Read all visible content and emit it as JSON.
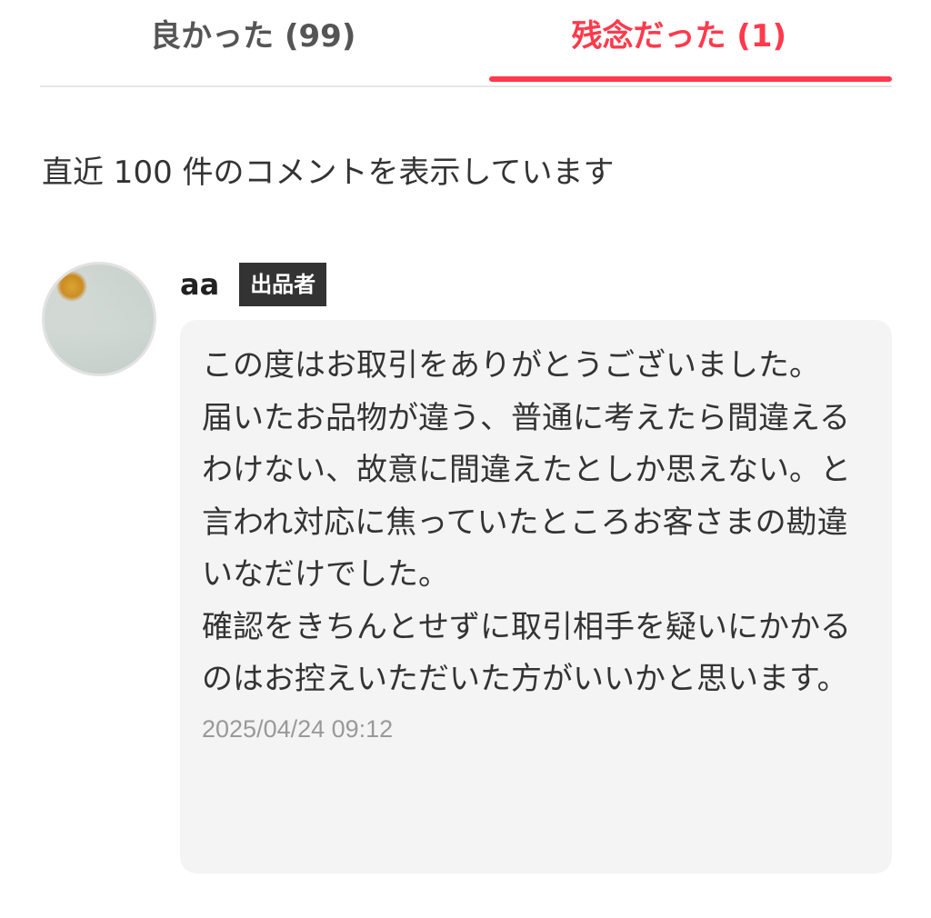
{
  "tabs": [
    {
      "label": "良かった (99)",
      "active": false
    },
    {
      "label": "残念だった (1)",
      "active": true
    }
  ],
  "notice": "直近 100 件のコメントを表示しています",
  "comment": {
    "username": "aa",
    "badge": "出品者",
    "text": "この度はお取引をありがとうございました。\n届いたお品物が違う、普通に考えたら間違えるわけない、故意に間違えたとしか思えない。と言われ対応に焦っていたところお客さまの勘違いなだけでした。\n確認をきちんとせずに取引相手を疑いにかかるのはお控えいただいた方がいいかと思います。",
    "timestamp": "2025/04/24 09:12"
  },
  "colors": {
    "accent": "#ff3a4c",
    "badge_bg": "#333333",
    "bubble_bg": "#f4f4f4",
    "muted": "#999999"
  }
}
